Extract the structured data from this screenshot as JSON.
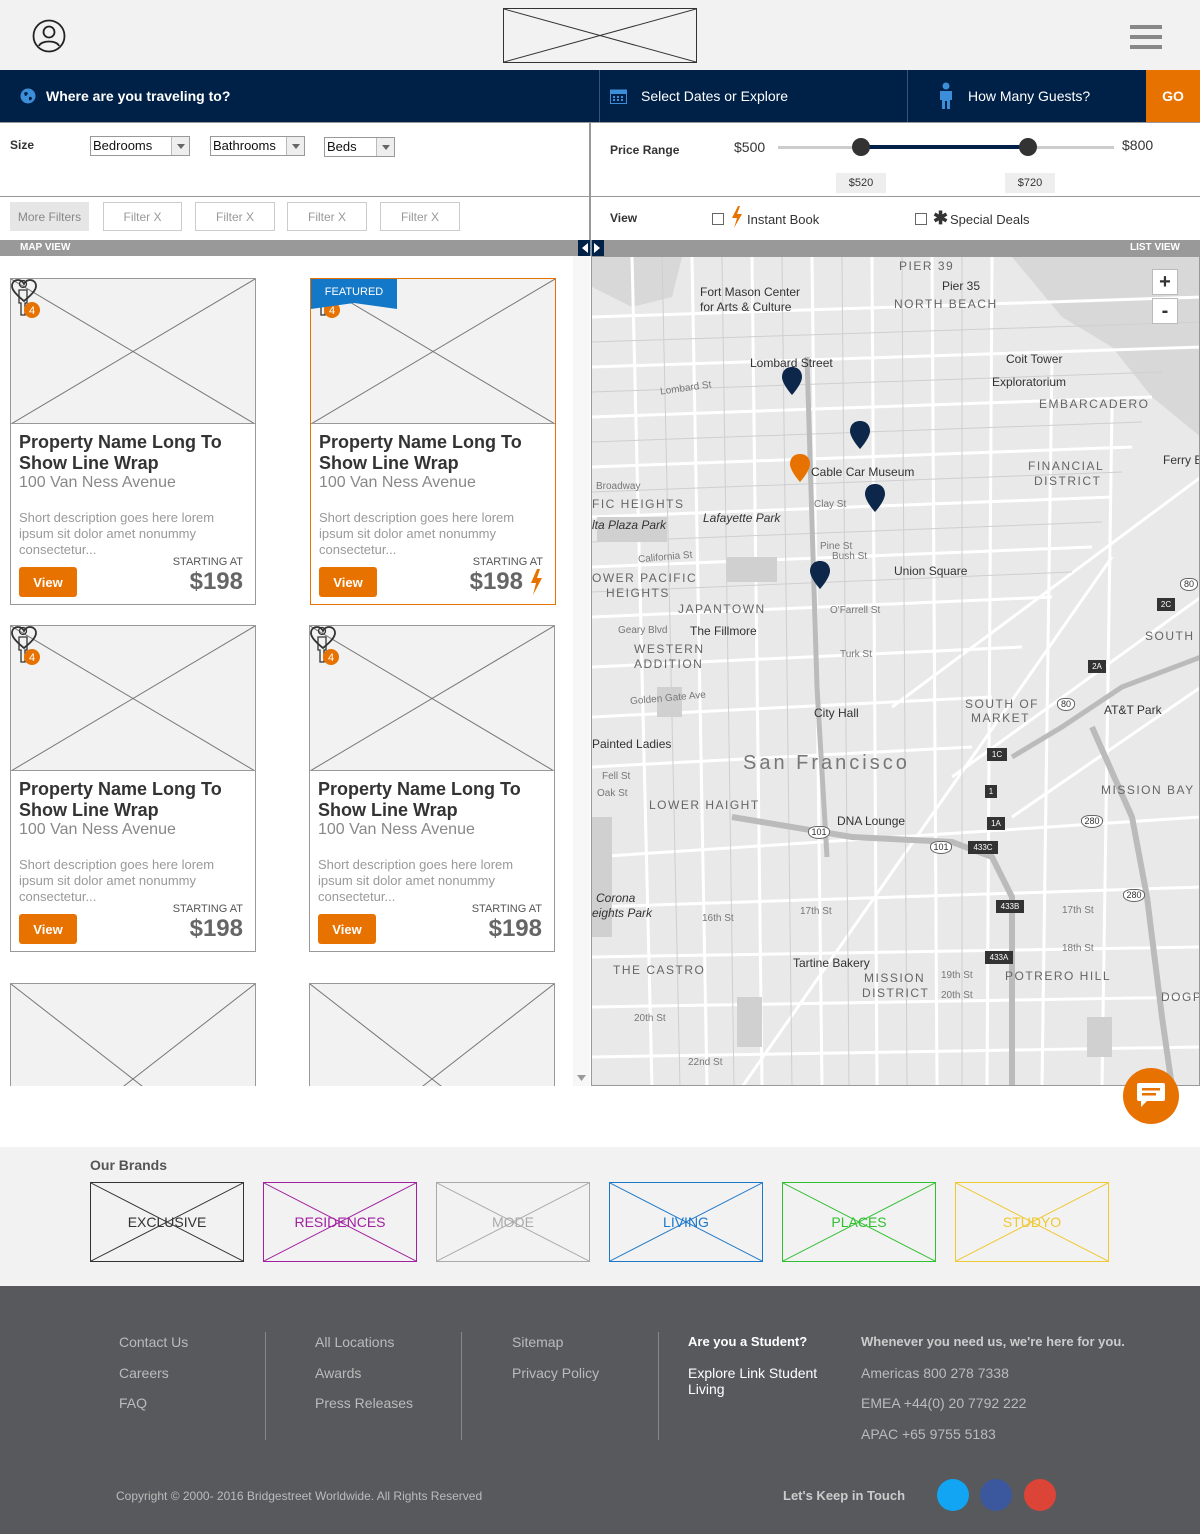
{
  "search": {
    "destination": "Where are you traveling to?",
    "dates": "Select Dates or Explore",
    "guests": "How Many Guests?",
    "go": "GO"
  },
  "filters": {
    "size_label": "Size",
    "bedrooms": "Bedrooms",
    "bathrooms": "Bathrooms",
    "beds": "Beds",
    "price_label": "Price Range",
    "price_min": "$500",
    "price_max": "$800",
    "price_low": "$520",
    "price_high": "$720",
    "price_low_fraction": 0.246,
    "price_high_fraction": 0.744,
    "more_filters": "More Filters",
    "chips": [
      "Filter  X",
      "Filter  X",
      "Filter  X",
      "Filter  X"
    ],
    "view_label": "View",
    "instant_book": "Instant Book",
    "special_deals": "Special Deals"
  },
  "bars": {
    "map_view": "MAP VIEW",
    "list_view": "LIST VIEW"
  },
  "listings": [
    {
      "name": "Property Name Long To Show Line Wrap",
      "address": "100 Van Ness Avenue",
      "description": "Short description goes here lorem ipsum sit dolor amet nonummy consectetur...",
      "starting": "STARTING AT",
      "price": "$198",
      "view": "View",
      "guests": "4"
    },
    {
      "name": "Property Name Long To Show Line Wrap",
      "address": "100 Van Ness Avenue",
      "description": "Short description goes here lorem ipsum sit dolor amet nonummy consectetur...",
      "starting": "STARTING AT",
      "price": "$198",
      "view": "View",
      "guests": "4",
      "featured": "FEATURED"
    },
    {
      "name": "Property Name Long To Show Line Wrap",
      "address": "100 Van Ness Avenue",
      "description": "Short description goes here lorem ipsum sit dolor amet nonummy consectetur...",
      "starting": "STARTING AT",
      "price": "$198",
      "view": "View",
      "guests": "4"
    },
    {
      "name": "Property Name Long To Show Line Wrap",
      "address": "100 Van Ness Avenue",
      "description": "Short description goes here lorem ipsum sit dolor amet nonummy consectetur...",
      "starting": "STARTING AT",
      "price": "$198",
      "view": "View",
      "guests": "4"
    }
  ],
  "map": {
    "zoom_in": "+",
    "zoom_out": "-",
    "labels": {
      "pier39": "PIER 39",
      "pier35": "Pier 35",
      "fort_mason": "Fort Mason Center",
      "fort_mason2": "for Arts & Culture",
      "north_beach": "NORTH BEACH",
      "lombard": "Lombard Street",
      "coit": "Coit Tower",
      "exploratorium": "Exploratorium",
      "embarcadero": "EMBARCADERO",
      "cable_car": "Cable Car Museum",
      "financial": "FINANCIAL",
      "district": "DISTRICT",
      "ferry": "Ferry Bu",
      "pacific_heights": "FIC HEIGHTS",
      "alta_plaza": "lta Plaza Park",
      "lafayette": "Lafayette Park",
      "union_square": "Union Square",
      "lower_pacific": "OWER PACIFIC",
      "heights": "HEIGHTS",
      "japantown": "JAPANTOWN",
      "fillmore": "The Fillmore",
      "western": "WESTERN",
      "addition": "ADDITION",
      "south_of": "SOUTH OF",
      "market": "MARKET",
      "att": "AT&T Park",
      "city_hall": "City Hall",
      "painted": "Painted Ladies",
      "san_francisco": "San Francisco",
      "lower_haight": "LOWER HAIGHT",
      "mission_bay": "MISSION BAY",
      "dna": "DNA Lounge",
      "corona": "Corona",
      "heights_park": "eights Park",
      "castro": "THE CASTRO",
      "tartine": "Tartine Bakery",
      "mission": "MISSION",
      "mission_district": "DISTRICT",
      "potrero": "POTRERO HILL",
      "dogpa": "DOGPA",
      "south_b": "SOUTH B",
      "lombard_st": "Lombard St",
      "broadway": "Broadway",
      "california": "California St",
      "geary": "Geary Blvd",
      "golden_gate": "Golden Gate Ave",
      "fell": "Fell St",
      "oak": "Oak St",
      "pine": "Pine St",
      "bush": "Bush St",
      "clay": "Clay St",
      "turk": "Turk St",
      "ofarrell": "O'Farrell St",
      "sixteenth": "16th St",
      "seventeenth": "17th St",
      "eighteenth": "18th St",
      "nineteenth": "19th St",
      "twentieth": "20th St",
      "twentysecond": "22nd St",
      "seventeenth_b": "17th St",
      "r101": "101",
      "r101b": "101",
      "r80": "80",
      "r80b": "80",
      "r280": "280",
      "r280b": "280",
      "e433c": "433C",
      "e433b": "433B",
      "e433a": "433A",
      "e1c": "1C",
      "e1": "1",
      "e1a": "1A",
      "e2a": "2A",
      "e2c": "2C"
    }
  },
  "brands": {
    "title": "Our Brands",
    "items": [
      {
        "label": "EXCLUSIVE",
        "color": "#333333"
      },
      {
        "label": "RESIDENCES",
        "color": "#a020a0"
      },
      {
        "label": "MODE",
        "color": "#aaaaaa"
      },
      {
        "label": "LIVING",
        "color": "#1e78c8"
      },
      {
        "label": "PLACES",
        "color": "#30c030"
      },
      {
        "label": "STUDYO",
        "color": "#f0c830"
      }
    ]
  },
  "footer": {
    "col1": [
      "Contact Us",
      "Careers",
      "FAQ"
    ],
    "col2": [
      "All Locations",
      "Awards",
      "Press Releases"
    ],
    "col3": [
      "Sitemap",
      "Privacy Policy"
    ],
    "student_title": "Are you a Student?",
    "student_link": "Explore Link Student Living",
    "contact_title": "Whenever you need us, we're here for you.",
    "contacts": [
      "Americas 800 278 7338",
      "EMEA +44(0) 20 7792 222",
      "APAC +65 9755 5183"
    ],
    "copyright": "Copyright © 2000- 2016 Bridgestreet Worldwide. All Rights Reserved",
    "keep_in_touch": "Let's Keep in Touch"
  },
  "colors": {
    "navy": "#002147",
    "accent": "#e87200",
    "twitter": "#1da1f2",
    "facebook": "#3b5998",
    "google": "#dd4b39"
  }
}
